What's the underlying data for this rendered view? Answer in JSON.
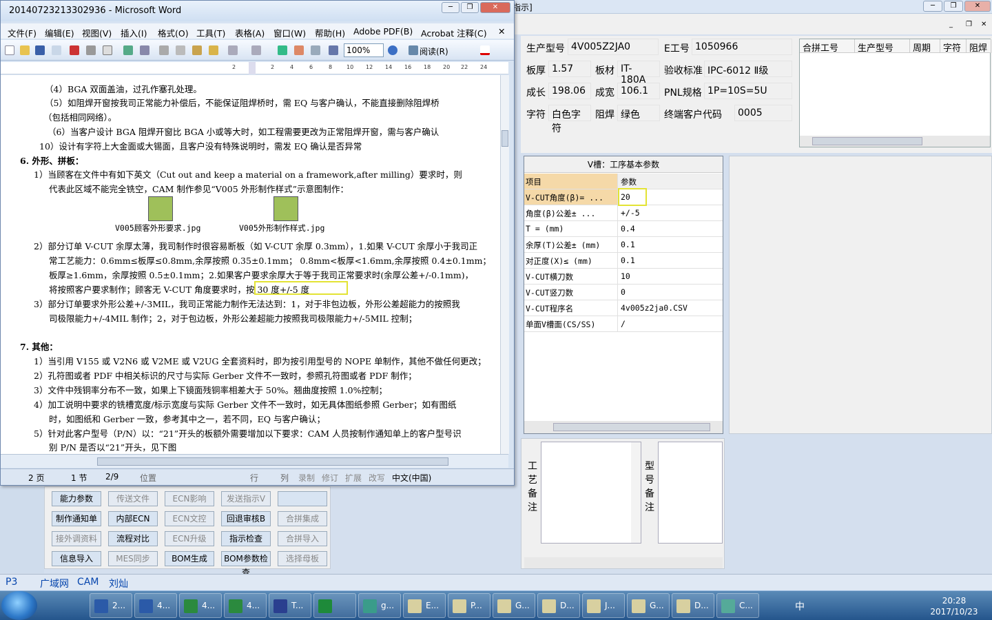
{
  "app": {
    "title_fragment": "指示]",
    "mdi_controls": [
      "_",
      "❐",
      "✕"
    ],
    "fields": {
      "prod_model_label": "生产型号",
      "prod_model": "4V005Z2JA0",
      "e_job_label": "E工号",
      "e_job": "1050966",
      "thickness_label": "板厚",
      "thickness": "1.57",
      "material_label": "板材",
      "material": "IT-180A",
      "accept_std_label": "验收标准",
      "accept_std": "IPC-6012 Ⅱ级",
      "grow_label": "成长",
      "grow": "198.06",
      "finish_thk_label": "成宽",
      "finish_thk": "106.1",
      "pnl_label": "PNL规格",
      "pnl": "1P=10S=5U",
      "char_label": "字符",
      "char": "白色字符",
      "mask_label": "阻焊",
      "mask": "绿色",
      "end_customer_label": "终端客户代码",
      "end_customer": "0005"
    },
    "merge_grid_headers": [
      "合拼工号",
      "生产型号",
      "周期",
      "字符",
      "阻焊"
    ],
    "vcut": {
      "title": "V槽：工序基本参数",
      "col_item": "项目",
      "col_param": "参数",
      "rows": [
        {
          "item": "V-CUT角度(β)=  ...",
          "value": "20"
        },
        {
          "item": "角度(β)公差±  ...",
          "value": "+/-5"
        },
        {
          "item": "T =  (mm)",
          "value": "0.4"
        },
        {
          "item": "余厚(T)公差±  (mm)",
          "value": "0.1"
        },
        {
          "item": "对正度(X)≤ (mm)",
          "value": "0.1"
        },
        {
          "item": "V-CUT横刀数",
          "value": "10"
        },
        {
          "item": "V-CUT竖刀数",
          "value": "0"
        },
        {
          "item": "V-CUT程序名",
          "value": "4v005z2ja0.CSV"
        },
        {
          "item": "单面V槽面(CS/SS)",
          "value": "/"
        }
      ]
    },
    "memo_labels": {
      "process": "工艺备注",
      "model": "型号备注"
    },
    "buttons": [
      {
        "label": "能力参数",
        "enabled": true
      },
      {
        "label": "传送文件",
        "enabled": false
      },
      {
        "label": "ECN影响",
        "enabled": false
      },
      {
        "label": "发送指示V",
        "enabled": false
      },
      {
        "label": "",
        "enabled": true
      },
      {
        "label": "制作通知单",
        "enabled": true
      },
      {
        "label": "内部ECN",
        "enabled": true
      },
      {
        "label": "ECN文控",
        "enabled": false
      },
      {
        "label": "回退审核B",
        "enabled": true
      },
      {
        "label": "合拼集成",
        "enabled": false
      },
      {
        "label": "接外调资料",
        "enabled": false
      },
      {
        "label": "流程对比",
        "enabled": true
      },
      {
        "label": "ECN升级",
        "enabled": false
      },
      {
        "label": "指示检查",
        "enabled": true
      },
      {
        "label": "合拼导入",
        "enabled": false
      },
      {
        "label": "信息导入",
        "enabled": true
      },
      {
        "label": "MES同步",
        "enabled": false
      },
      {
        "label": "BOM生成",
        "enabled": true
      },
      {
        "label": "BOM参数检查",
        "enabled": true
      },
      {
        "label": "选择母板",
        "enabled": false
      }
    ],
    "tabs": {
      "p3": "P3",
      "lan": "广域网",
      "cam": "CAM",
      "user": "刘灿"
    }
  },
  "word": {
    "title": "20140723213302936 - Microsoft Word",
    "menu": [
      "文件(F)",
      "编辑(E)",
      "视图(V)",
      "插入(I)",
      "格式(O)",
      "工具(T)",
      "表格(A)",
      "窗口(W)",
      "帮助(H)",
      "Adobe PDF(B)",
      "Acrobat 注释(C)"
    ],
    "zoom": "100%",
    "read_label": "阅读(R)",
    "ruler": [
      "2",
      "2",
      "4",
      "6",
      "8",
      "10",
      "12",
      "14",
      "16",
      "18",
      "20",
      "22",
      "24"
    ],
    "lines": [
      "（4）BGA 双面盖油，过孔作塞孔处理。",
      "（5）如阻焊开窗按我司正常能力补偿后，不能保证阻焊桥时，需 EQ 与客户确认，不能直接删除阻焊桥",
      "（包括相同网络）。",
      "（6）当客户设计 BGA 阻焊开窗比 BGA 小或等大时，如工程需要更改为正常阻焊开窗，需与客户确认",
      "10）设计有字符上大金面或大锡面，且客户没有特殊说明时，需发 EQ 确认是否异常",
      "6.   外形、拼板：",
      "1）当顾客在文件中有如下英文（Cut out and keep a material on a framework,after milling）要求时，则",
      "代表此区域不能完全铣空，CAM 制作参见“V005 外形制作样式”示意图制作：",
      "V005顾客外形要求.jpg",
      "V005外形制作样式.jpg",
      "2）部分订单 V-CUT 余厚太薄，我司制作时很容易断板（如 V-CUT 余厚 0.3mm），1.如果 V-CUT 余厚小于我司正",
      "常工艺能力：0.6mm≤板厚≤0.8mm,余厚按照 0.35±0.1mm； 0.8mm<板厚<1.6mm,余厚按照 0.4±0.1mm；",
      "板厚≥1.6mm，余厚按照 0.5±0.1mm；2.如果客户要求余厚大于等于我司正常要求时(余厚公差+/-0.1mm)，",
      "将按照客户要求制作；顾客无 V-CUT 角度要求时，按 30 度+/-5 度",
      "3）部分订单要求外形公差+/-3MIL，我司正常能力制作无法达到：1，对于非包边板，外形公差超能力的按照我",
      "司极限能力+/-4MIL 制作；2，对于包边板，外形公差超能力按照我司极限能力+/-5MIL 控制；",
      "7.   其他：",
      "1）当引用 V155 或 V2N6 或 V2ME 或 V2UG 全套资料时，即为按引用型号的 NOPE 单制作，其他不做任何更改；",
      "2）孔符图或者 PDF 中相关标识的尺寸与实际 Gerber 文件不一致时，参照孔符图或者 PDF 制作；",
      "3）文件中残铜率分布不一致，如果上下镜面残铜率相差大于 50%。翘曲度按照 1.0%控制；",
      "4）加工说明中要求的铣槽宽度/标示宽度与实际 Gerber 文件不一致时，如无具体图纸参照 Gerber；如有图纸",
      "时，如图纸和 Gerber 一致，参考其中之一，若不同，EQ 与客户确认；",
      "5）针对此客户型号（P/N）以：“21”开头的板额外需要增加以下要求：CAM 人员按制作通知单上的客户型号识",
      "别 P/N 是否以“21”开头，见下图"
    ],
    "status": {
      "page": "2 页",
      "section": "1 节",
      "pages": "2/9",
      "pos": "位置",
      "row": "行",
      "col": "列",
      "rec": "录制",
      "rev": "修订",
      "ext": "扩展",
      "ovr": "改写",
      "lang": "中文(中国)"
    }
  },
  "taskbar": {
    "items": [
      "2...",
      "4...",
      "4...",
      "4...",
      "T...",
      "",
      "g...",
      "E...",
      "P...",
      "G...",
      "D...",
      "J...",
      "G...",
      "D...",
      "C..."
    ],
    "ime": "中",
    "time": "20:28",
    "date": "2017/10/23"
  },
  "colors": {
    "highlight": "#e3e333",
    "link": "#0645ad",
    "vcut_header": "#f5d9a8"
  }
}
